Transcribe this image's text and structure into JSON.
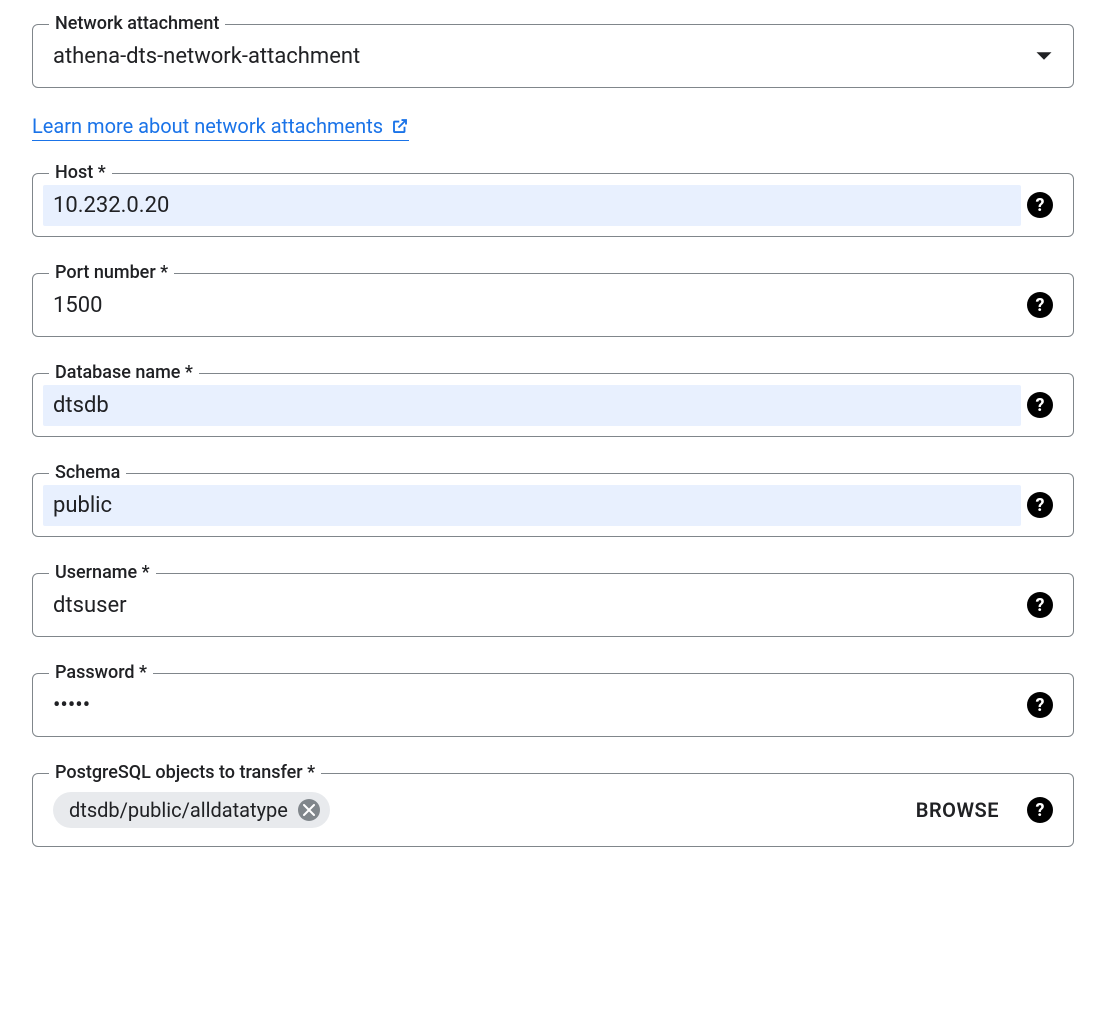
{
  "network_attachment": {
    "label": "Network attachment",
    "value": "athena-dts-network-attachment"
  },
  "learn_more": {
    "text": "Learn more about network attachments"
  },
  "host": {
    "label": "Host *",
    "value": "10.232.0.20"
  },
  "port": {
    "label": "Port number *",
    "value": "1500"
  },
  "database": {
    "label": "Database name *",
    "value": "dtsdb"
  },
  "schema": {
    "label": "Schema",
    "value": "public"
  },
  "username": {
    "label": "Username *",
    "value": "dtsuser"
  },
  "password": {
    "label": "Password *",
    "value": "•••••"
  },
  "objects": {
    "label": "PostgreSQL objects to transfer *",
    "chip": "dtsdb/public/alldatatype",
    "browse": "BROWSE"
  }
}
